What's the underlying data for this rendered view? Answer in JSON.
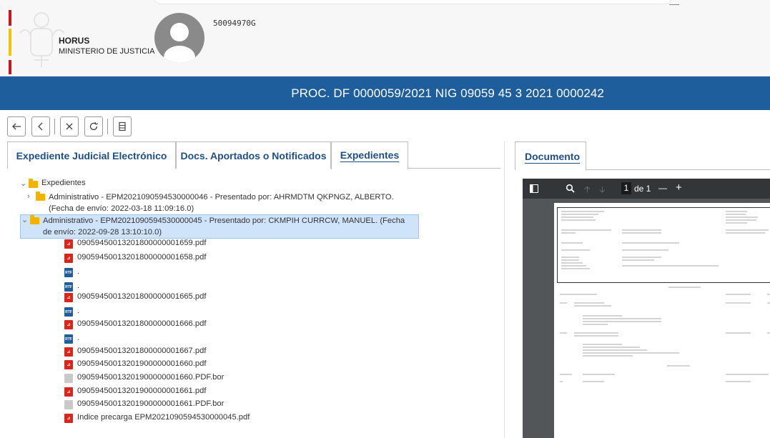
{
  "header": {
    "org": "HORUS",
    "ministry": "MINISTERIO DE JUSTICIA",
    "user_code": "50094970G"
  },
  "banner": {
    "title": "PROC. DF 0000059/2021 NIG 09059 45 3 2021 0000242"
  },
  "toolbar": {
    "icons": [
      "back-arrow-icon",
      "chevron-left-icon",
      "close-x-icon",
      "refresh-icon",
      "document-list-icon"
    ]
  },
  "tabs": [
    {
      "label": "Expediente Judicial Electrónico",
      "active": false
    },
    {
      "label": "Docs. Aportados o Notificados",
      "active": false
    },
    {
      "label": "Expedientes",
      "active": true
    }
  ],
  "tree": {
    "root": "Expedientes",
    "items": [
      {
        "label": "Administrativo - EPM2021090594530000046 - Presentado por: AHRMDTM QKPNGZ, ALBERTO. (Fecha de envío: 2022-03-18 11:09:16.0)"
      },
      {
        "label": "Administrativo - EPM2021090594530000045 - Presentado por: CKMPIH CURRCW, MANUEL. (Fecha de envío: 2022-09-28 13:10:10.0)",
        "selected": true
      }
    ],
    "files": [
      {
        "type": "pdf",
        "name": "09059450013201800000001659.pdf"
      },
      {
        "type": "pdf",
        "name": "09059450013201800000001658.pdf"
      },
      {
        "type": "rtf",
        "name": "."
      },
      {
        "type": "rtf",
        "name": "."
      },
      {
        "type": "pdf",
        "name": "09059450013201800000001665.pdf"
      },
      {
        "type": "rtf",
        "name": "."
      },
      {
        "type": "pdf",
        "name": "09059450013201800000001666.pdf"
      },
      {
        "type": "rtf",
        "name": "."
      },
      {
        "type": "pdf",
        "name": "09059450013201800000001667.pdf"
      },
      {
        "type": "pdf",
        "name": "09059450013201900000001660.pdf"
      },
      {
        "type": "bor",
        "name": "09059450013201900000001660.PDF.bor"
      },
      {
        "type": "pdf",
        "name": "09059450013201900000001661.pdf"
      },
      {
        "type": "bor",
        "name": "09059450013201900000001661.PDF.bor"
      },
      {
        "type": "pdf",
        "name": "Indice precarga EPM2021090594530000045.pdf"
      }
    ]
  },
  "document": {
    "tab_label": "Documento",
    "page_current": "1",
    "page_of": "de 1",
    "zoom_out": "—",
    "zoom_in": "+"
  },
  "colors": {
    "banner": "#1f5e9c",
    "link": "#1f4f86",
    "selected": "#cfe4fa",
    "pdf": "#d9261c",
    "folder": "#f0b400"
  }
}
